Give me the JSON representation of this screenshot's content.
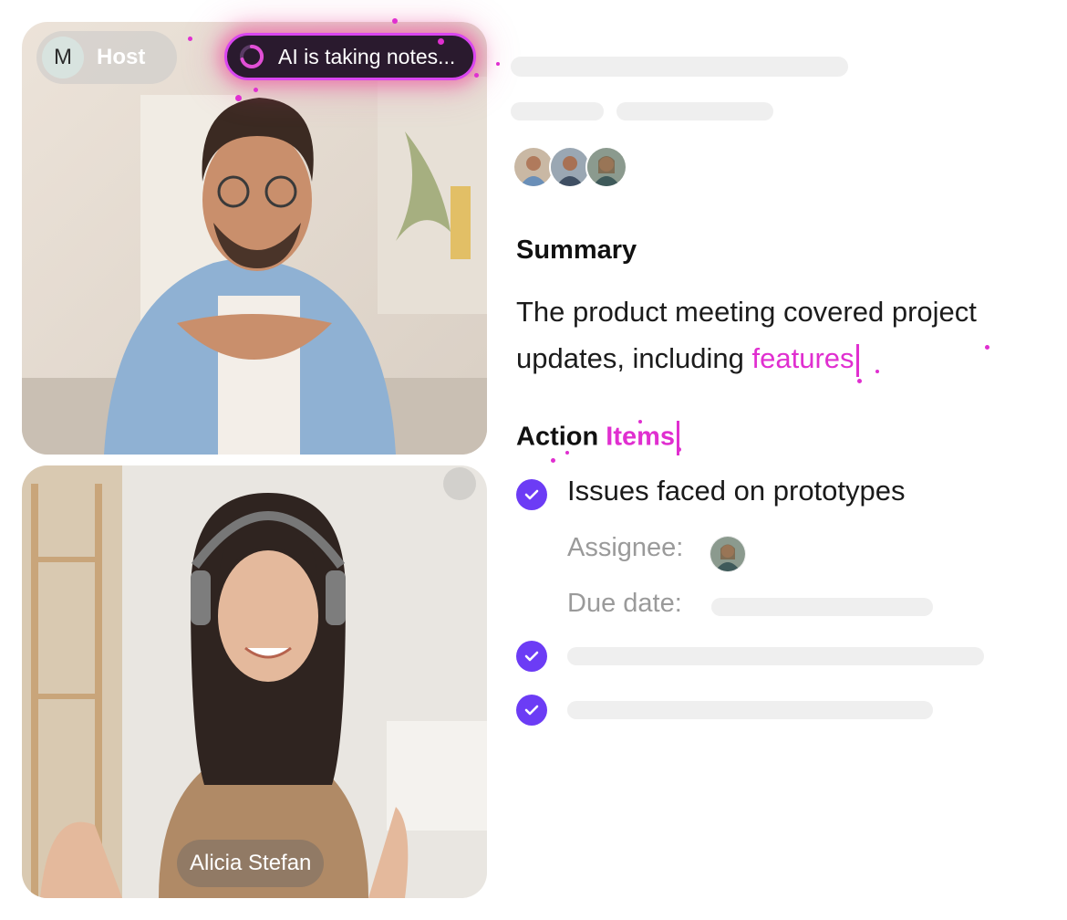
{
  "video": {
    "host": {
      "avatar_letter": "M",
      "label": "Host"
    },
    "ai_status": {
      "label": "AI is taking notes...",
      "accent": "#d946ef"
    },
    "guest": {
      "name": "Alicia Stefan"
    }
  },
  "notes": {
    "summary_heading": "Summary",
    "summary_text": "The product meeting covered project updates, including ",
    "summary_typing": "features",
    "action_heading_static": "Action",
    "action_heading_typing": "Items",
    "items": [
      {
        "label": "Issues faced on prototypes",
        "checked": true,
        "assignee_label": "Assignee:",
        "due_label": "Due date:"
      },
      {
        "label": "",
        "checked": true
      },
      {
        "label": "",
        "checked": true
      }
    ]
  },
  "colors": {
    "accent": "#6c3cf5",
    "typing_highlight": "#e02fd0",
    "skeleton": "#efefef"
  }
}
